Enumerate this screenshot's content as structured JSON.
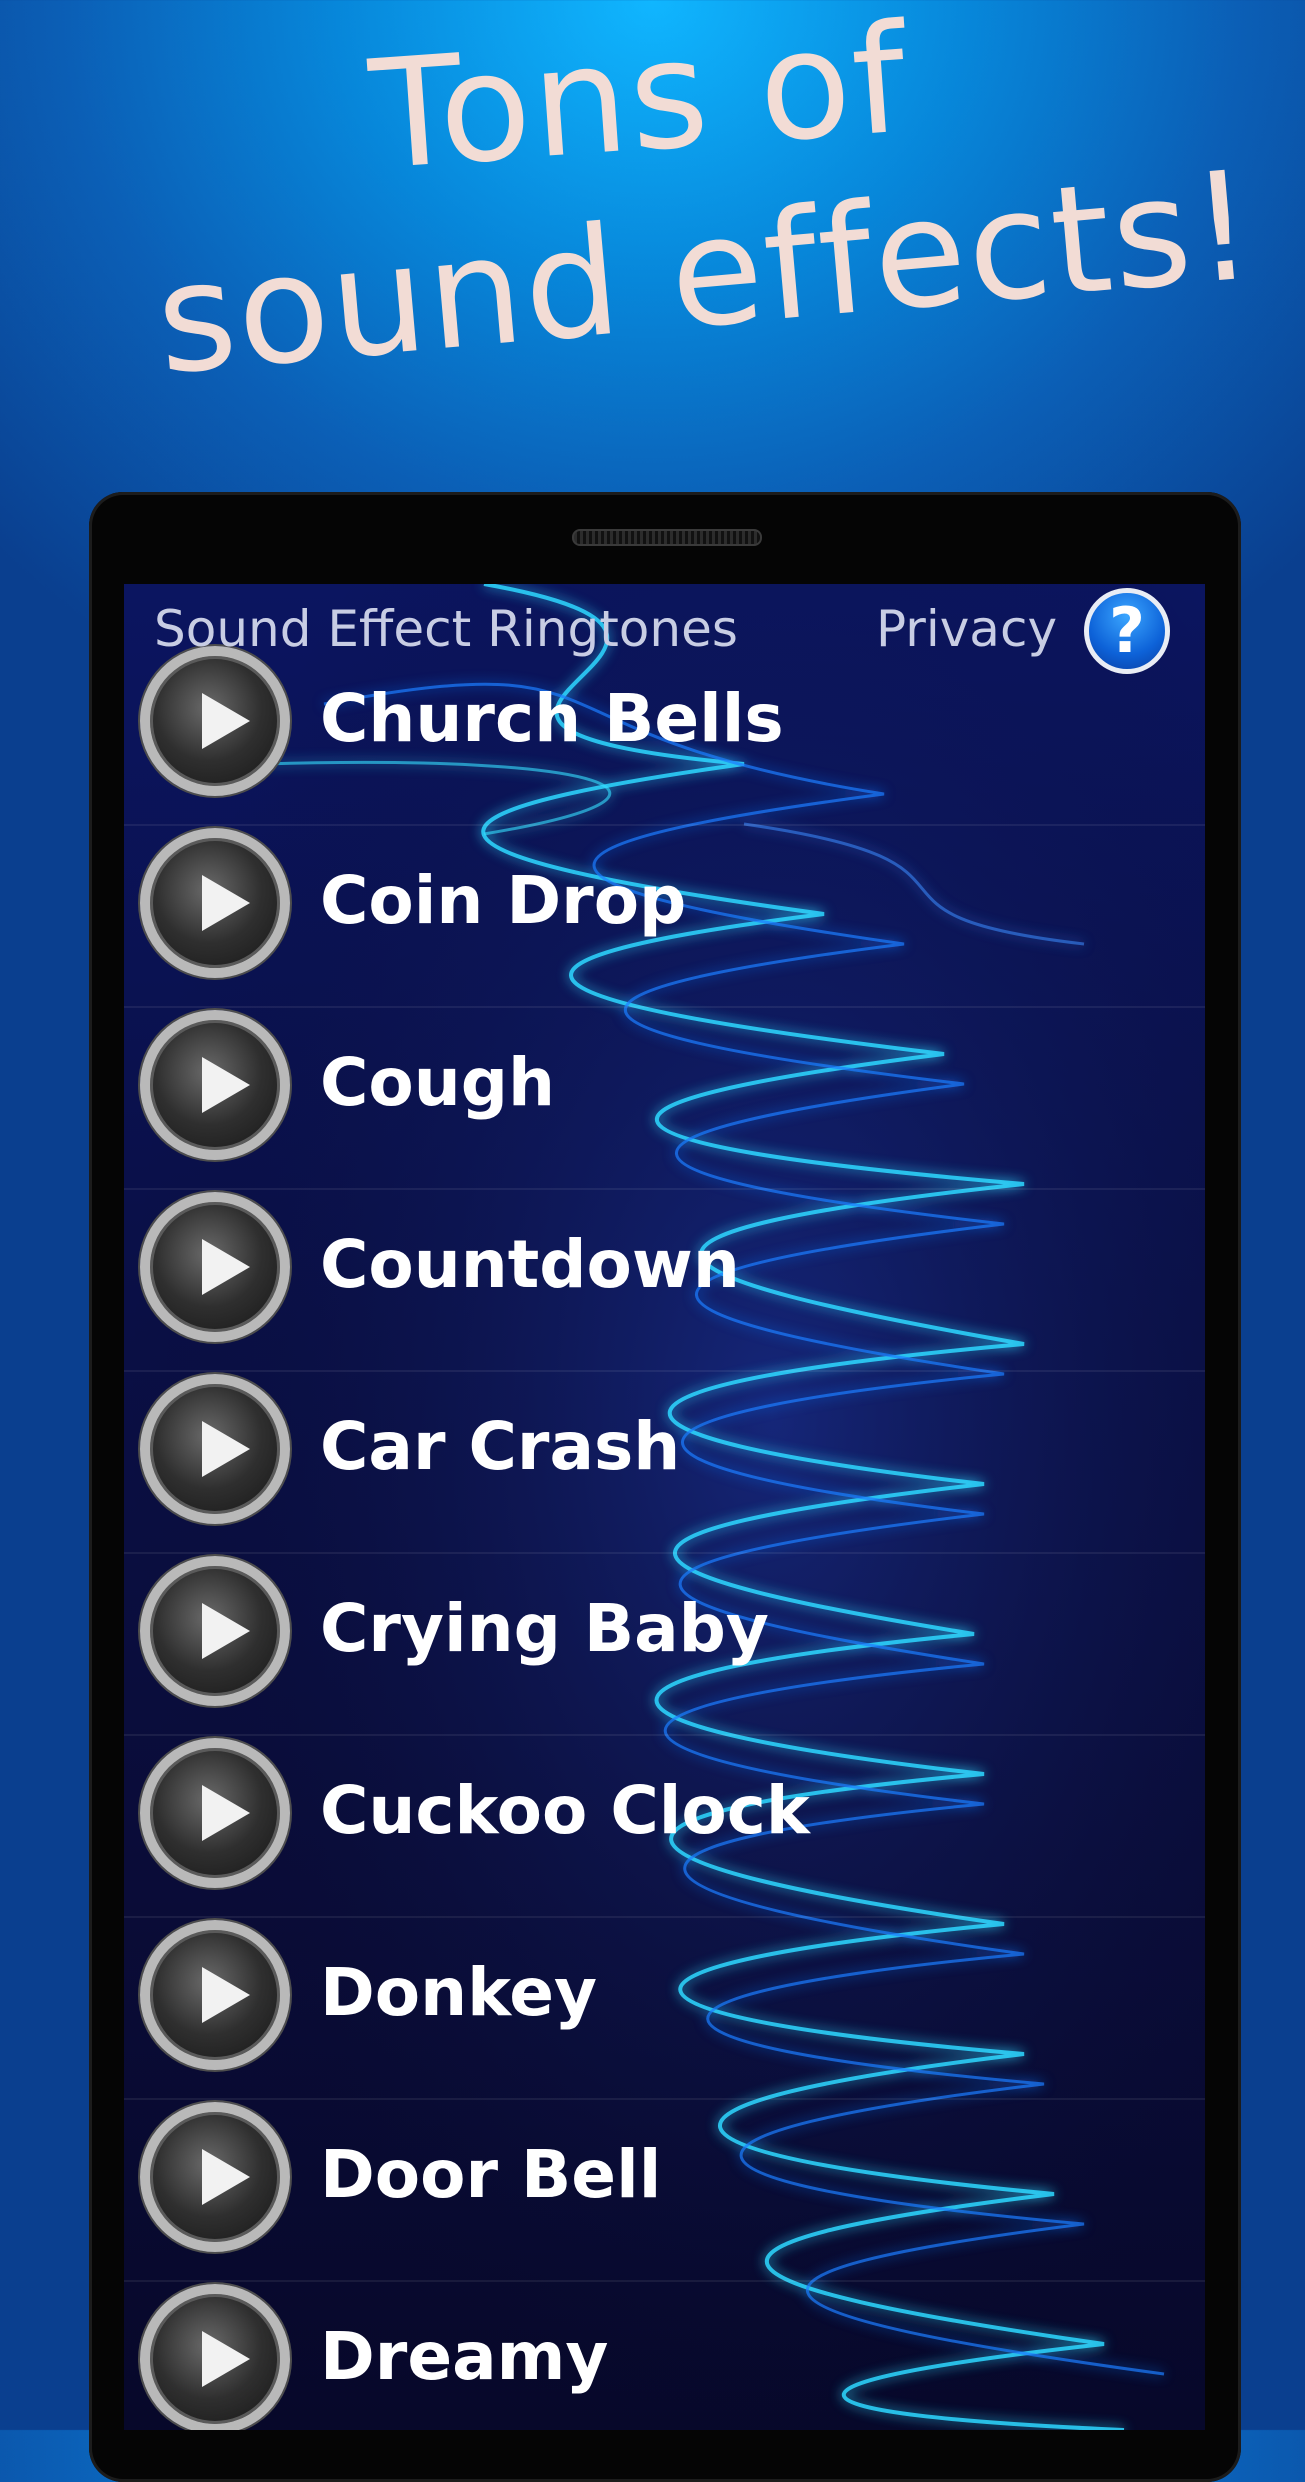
{
  "headline": {
    "line1": "Tons of",
    "line2": "sound effects!"
  },
  "app_bar": {
    "title": "Sound Effect Ringtones",
    "privacy_label": "Privacy",
    "help_glyph": "?"
  },
  "sounds": [
    {
      "label": "Church Bells"
    },
    {
      "label": "Coin Drop"
    },
    {
      "label": "Cough"
    },
    {
      "label": "Countdown"
    },
    {
      "label": "Car Crash"
    },
    {
      "label": "Crying Baby"
    },
    {
      "label": "Cuckoo Clock"
    },
    {
      "label": "Donkey"
    },
    {
      "label": "Door Bell"
    },
    {
      "label": "Dreamy"
    }
  ],
  "icons": {
    "play": "play-icon",
    "help": "question-circle-icon"
  },
  "colors": {
    "background_top": "#10b6ff",
    "background_bottom": "#0a3f8f",
    "headline_text": "#f2dcd5",
    "list_text": "#ffffff"
  }
}
